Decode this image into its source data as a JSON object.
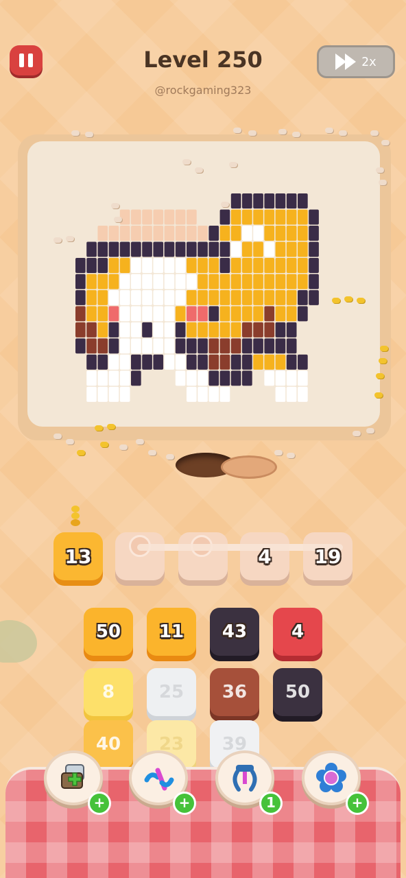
{
  "header": {
    "level_title": "Level 250",
    "username": "@rockgaming323",
    "speed_label": "2x"
  },
  "slots": [
    {
      "value": "13",
      "state": "filled",
      "color": "#fbb731"
    },
    {
      "value": "",
      "state": "empty"
    },
    {
      "value": "",
      "state": "empty"
    },
    {
      "value": "4",
      "state": "empty"
    },
    {
      "value": "19",
      "state": "empty"
    }
  ],
  "tiles": [
    {
      "value": "50",
      "color": "#fbb42c"
    },
    {
      "value": "11",
      "color": "#fbb42c"
    },
    {
      "value": "43",
      "color": "#3b3140"
    },
    {
      "value": "4",
      "color": "#e5474c"
    },
    {
      "value": "8",
      "color": "#fde06a"
    },
    {
      "value": "25",
      "color": "#eef0f2"
    },
    {
      "value": "36",
      "color": "#a6503a"
    },
    {
      "value": "50",
      "color": "#3b3140"
    },
    {
      "value": "40",
      "color": "#fbc14a"
    },
    {
      "value": "23",
      "color": "#fce8a6"
    },
    {
      "value": "39",
      "color": "#f0f1f3"
    }
  ],
  "powerups": [
    {
      "icon": "add-tile-icon",
      "badge": "+"
    },
    {
      "icon": "magnet-swap-icon",
      "badge": "+"
    },
    {
      "icon": "claw-icon",
      "badge": "1"
    },
    {
      "icon": "flower-icon",
      "badge": "+"
    }
  ],
  "colors": {
    "background": "#f6c996",
    "board": "#f3e7d6",
    "pause": "#d9413f",
    "tray": "#e8646c"
  }
}
